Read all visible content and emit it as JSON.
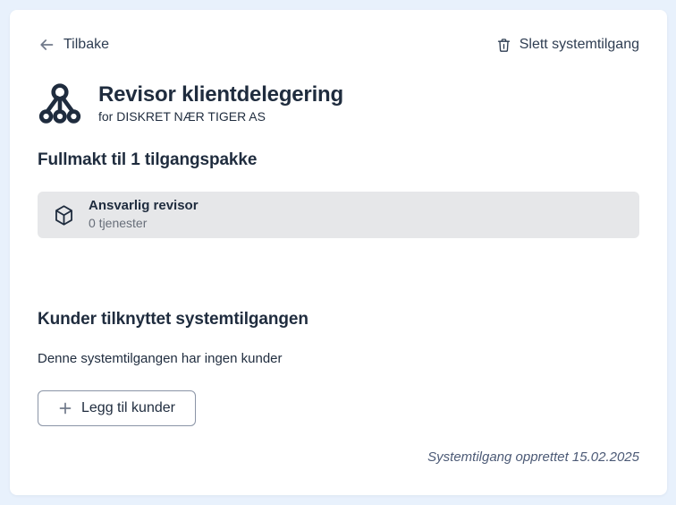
{
  "header": {
    "back_label": "Tilbake",
    "delete_label": "Slett systemtilgang"
  },
  "title": {
    "heading": "Revisor klientdelegering",
    "subtitle": "for DISKRET NÆR TIGER AS"
  },
  "packages": {
    "heading": "Fullmakt til 1 tilgangspakke",
    "items": [
      {
        "name": "Ansvarlig revisor",
        "services": "0 tjenester"
      }
    ]
  },
  "customers": {
    "heading": "Kunder tilknyttet systemtilgangen",
    "empty_text": "Denne systemtilgangen har ingen kunder",
    "add_button_label": "Legg til kunder"
  },
  "footer": {
    "created_text": "Systemtilgang opprettet 15.02.2025"
  },
  "icons": {
    "back": "arrow-left-icon",
    "delete": "trash-icon",
    "title": "hierarchy-icon",
    "package": "package-cube-icon",
    "add": "plus-icon"
  },
  "colors": {
    "page_background": "#e8f1fc",
    "card_background": "#ffffff",
    "text_primary": "#1f2c3e",
    "text_muted": "#676e79",
    "footer_text": "#4c5a76",
    "row_background": "#e6e7e9",
    "button_border": "#8a94a6",
    "icon_gray": "#70798a"
  }
}
